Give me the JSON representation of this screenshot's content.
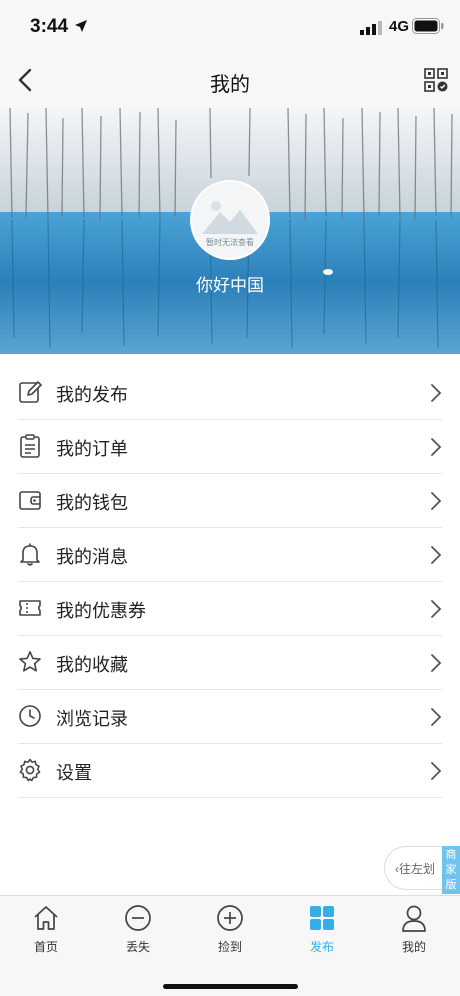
{
  "status_bar": {
    "time": "3:44",
    "network": "4G"
  },
  "nav": {
    "title": "我的"
  },
  "profile": {
    "avatar_note": "暂时无法查看",
    "name": "你好中国"
  },
  "menu": {
    "items": [
      {
        "label": "我的发布",
        "icon": "edit-icon"
      },
      {
        "label": "我的订单",
        "icon": "order-clipboard-icon"
      },
      {
        "label": "我的钱包",
        "icon": "wallet-icon"
      },
      {
        "label": "我的消息",
        "icon": "bell-icon"
      },
      {
        "label": "我的优惠券",
        "icon": "coupon-icon"
      },
      {
        "label": "我的收藏",
        "icon": "star-icon"
      },
      {
        "label": "浏览记录",
        "icon": "clock-icon"
      },
      {
        "label": "设置",
        "icon": "gear-icon"
      }
    ]
  },
  "floating": {
    "pill_text": "‹往左划",
    "tag_text": "商家版"
  },
  "tabs": [
    {
      "label": "首页",
      "icon": "home-icon"
    },
    {
      "label": "丢失",
      "icon": "minus-circle-icon"
    },
    {
      "label": "捡到",
      "icon": "plus-circle-icon"
    },
    {
      "label": "发布",
      "icon": "grid-icon",
      "active": true
    },
    {
      "label": "我的",
      "icon": "user-icon"
    }
  ],
  "colors": {
    "accent": "#34aeea",
    "tag_bg": "#6dc4ef",
    "bar_bg": "#f7f7f7"
  }
}
